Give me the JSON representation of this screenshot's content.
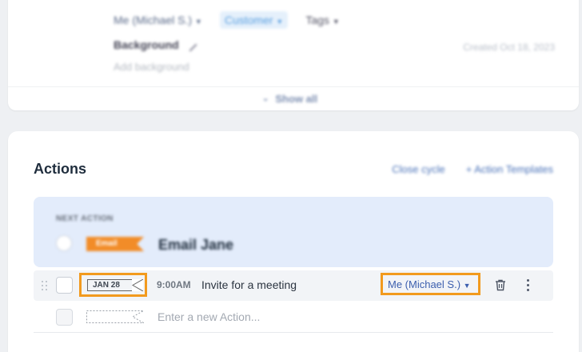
{
  "top": {
    "owner": "Me (Michael S.)",
    "stage": "Customer",
    "tags": "Tags",
    "background_label": "Background",
    "created": "Created Oct 18, 2023",
    "background_placeholder": "Add background",
    "show_all": "Show all"
  },
  "actions": {
    "title": "Actions",
    "close_cycle": "Close cycle",
    "templates": "Action Templates",
    "next_action_label": "NEXT ACTION",
    "next_action": {
      "badge": "Email",
      "title": "Email Jane"
    },
    "row": {
      "date": "JAN 28",
      "time": "9:00AM",
      "title": "Invite for a meeting",
      "assignee": "Me (Michael S.)"
    },
    "new_placeholder": "Enter a new Action..."
  },
  "colors": {
    "highlight": "#f29a1e",
    "accent_blue": "#3c5fae",
    "email_badge": "#f28c28"
  }
}
